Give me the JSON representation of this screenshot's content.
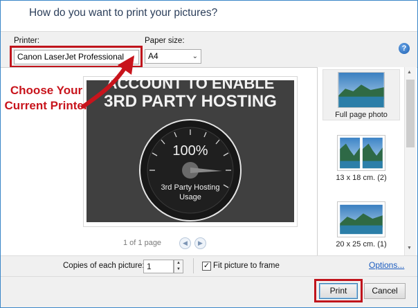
{
  "window": {
    "heading": "How do you want to print your pictures?"
  },
  "controls": {
    "printer_label": "Printer:",
    "printer_value": "Canon LaserJet Professional",
    "paper_size_label": "Paper size:",
    "paper_size_value": "A4",
    "help_icon": "help-icon"
  },
  "annotation": {
    "line1": "Choose Your",
    "line2": "Current Printer",
    "color": "#c8141c"
  },
  "preview": {
    "image_text_top": "ACCOUNT TO ENABLE",
    "image_text_main": "3RD PARTY HOSTING",
    "gauge_percent": "100%",
    "gauge_label_1": "3rd Party Hosting",
    "gauge_label_2": "Usage",
    "page_indicator": "1 of 1 page"
  },
  "layouts": [
    {
      "label": "Full page photo",
      "selected": true
    },
    {
      "label": "13 x 18 cm. (2)",
      "selected": false
    },
    {
      "label": "20 x 25 cm. (1)",
      "selected": false
    }
  ],
  "options": {
    "copies_label": "Copies of each picture:",
    "copies_value": "1",
    "fit_label": "Fit picture to frame",
    "fit_checked": true,
    "options_link": "Options..."
  },
  "buttons": {
    "print": "Print",
    "cancel": "Cancel"
  },
  "colors": {
    "accent_border": "#3a86c8",
    "highlight": "#c0141c",
    "link": "#1a5bbf"
  }
}
